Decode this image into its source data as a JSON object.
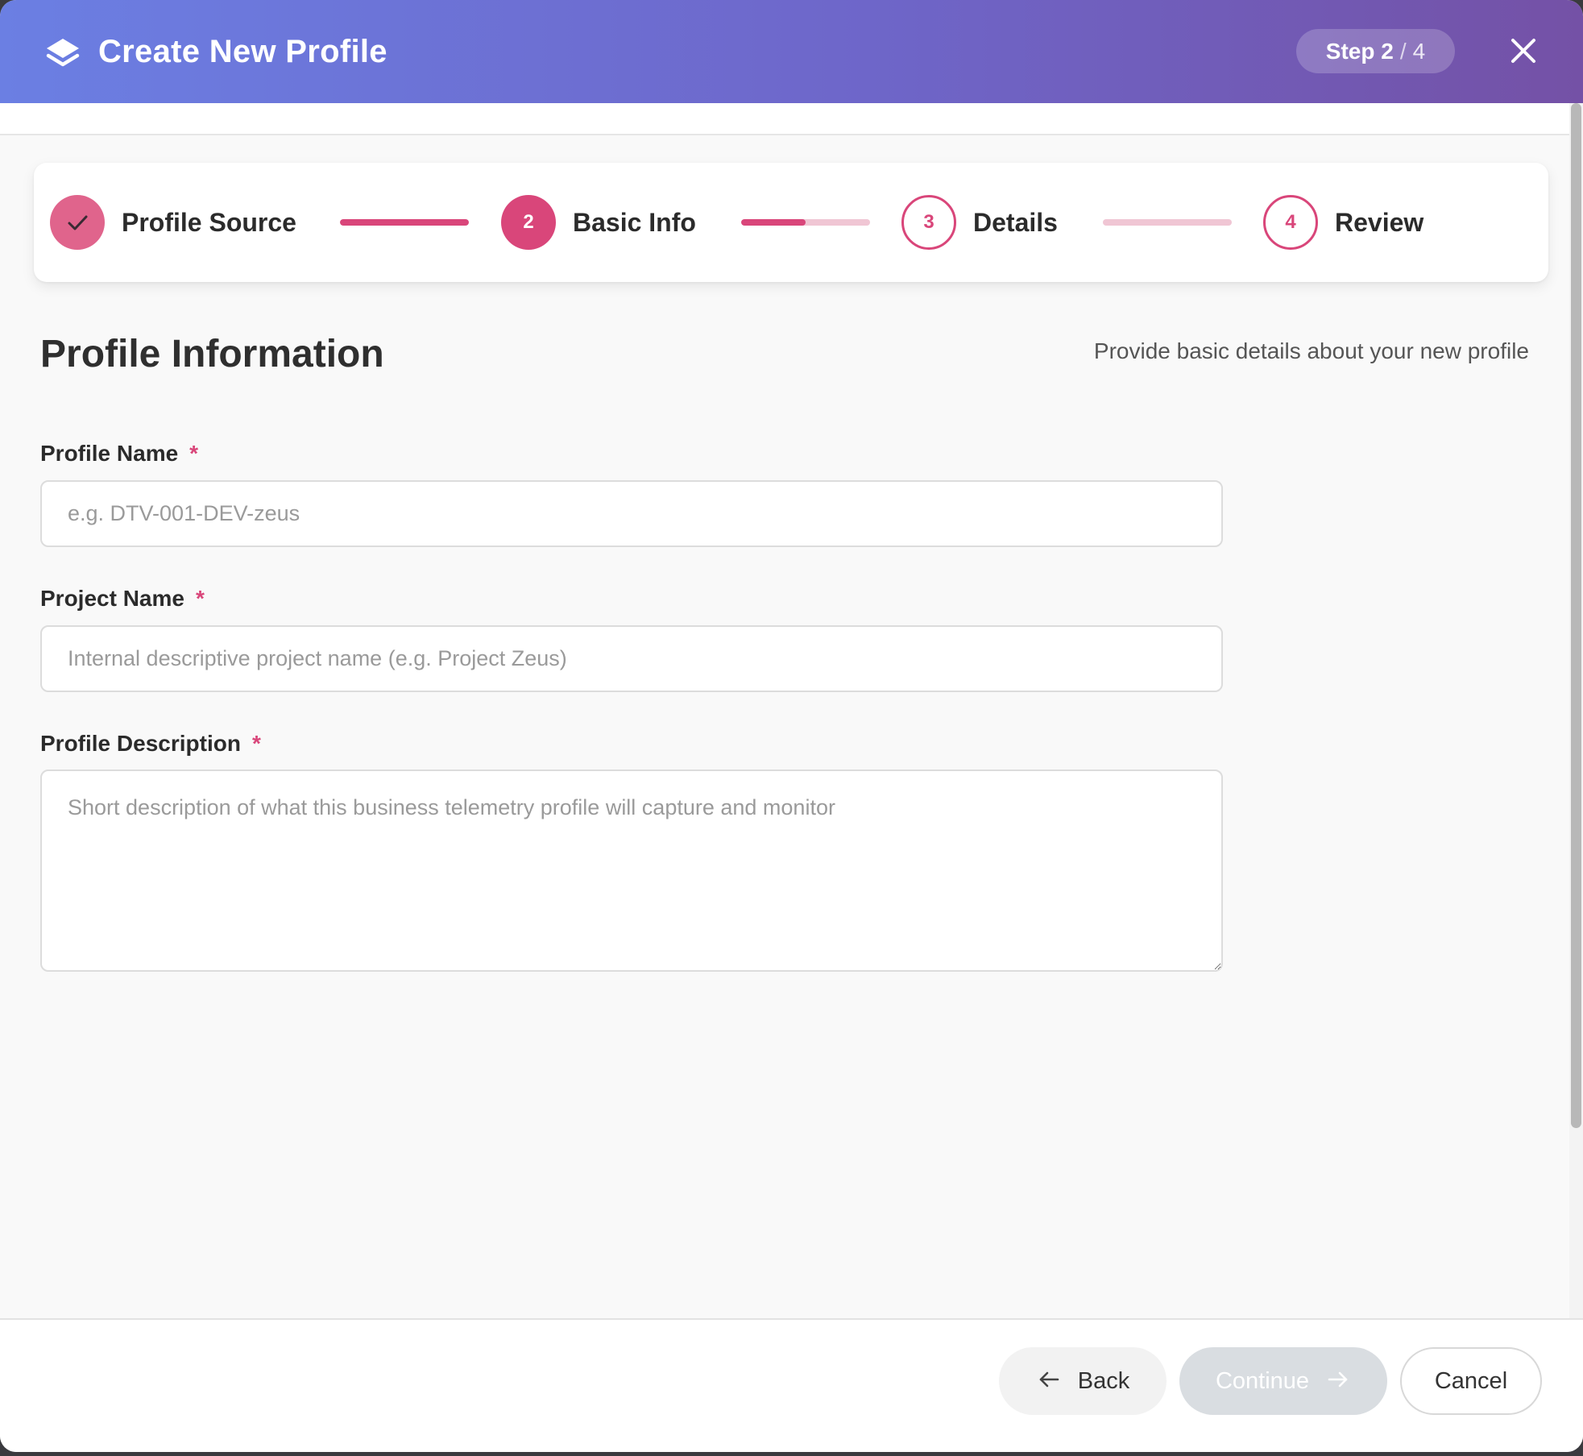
{
  "header": {
    "title": "Create New Profile",
    "step_word": "Step",
    "step_current": "2",
    "step_separator": "/",
    "step_total": "4"
  },
  "stepper": {
    "steps": [
      {
        "label": "Profile Source",
        "number": "",
        "state": "completed"
      },
      {
        "label": "Basic Info",
        "number": "2",
        "state": "active"
      },
      {
        "label": "Details",
        "number": "3",
        "state": "upcoming"
      },
      {
        "label": "Review",
        "number": "4",
        "state": "upcoming"
      }
    ],
    "connectors": [
      {
        "progress": 1.0
      },
      {
        "progress": 0.5
      },
      {
        "progress": 0.0
      }
    ]
  },
  "section": {
    "title": "Profile Information",
    "subtitle": "Provide basic details about your new profile"
  },
  "form": {
    "profile_name": {
      "label": "Profile Name",
      "required_marker": "*",
      "value": "",
      "placeholder": "e.g. DTV-001-DEV-zeus"
    },
    "project_name": {
      "label": "Project Name",
      "required_marker": "*",
      "value": "",
      "placeholder": "Internal descriptive project name (e.g. Project Zeus)"
    },
    "profile_description": {
      "label": "Profile Description",
      "required_marker": "*",
      "value": "",
      "placeholder": "Short description of what this business telemetry profile will capture and monitor"
    }
  },
  "footer": {
    "back_label": "Back",
    "continue_label": "Continue",
    "cancel_label": "Cancel"
  },
  "icons": {
    "logo": "layers-icon",
    "close": "close-icon",
    "completed_step": "check-icon",
    "back": "arrow-left-icon",
    "continue": "arrow-right-icon"
  },
  "colors": {
    "header_gradient_start": "#6b7fe3",
    "header_gradient_end": "#7451a6",
    "accent": "#d9467a",
    "accent_light": "#f0c6d4",
    "completed_step": "#e0648c",
    "continue_disabled": "#d9dde1"
  }
}
